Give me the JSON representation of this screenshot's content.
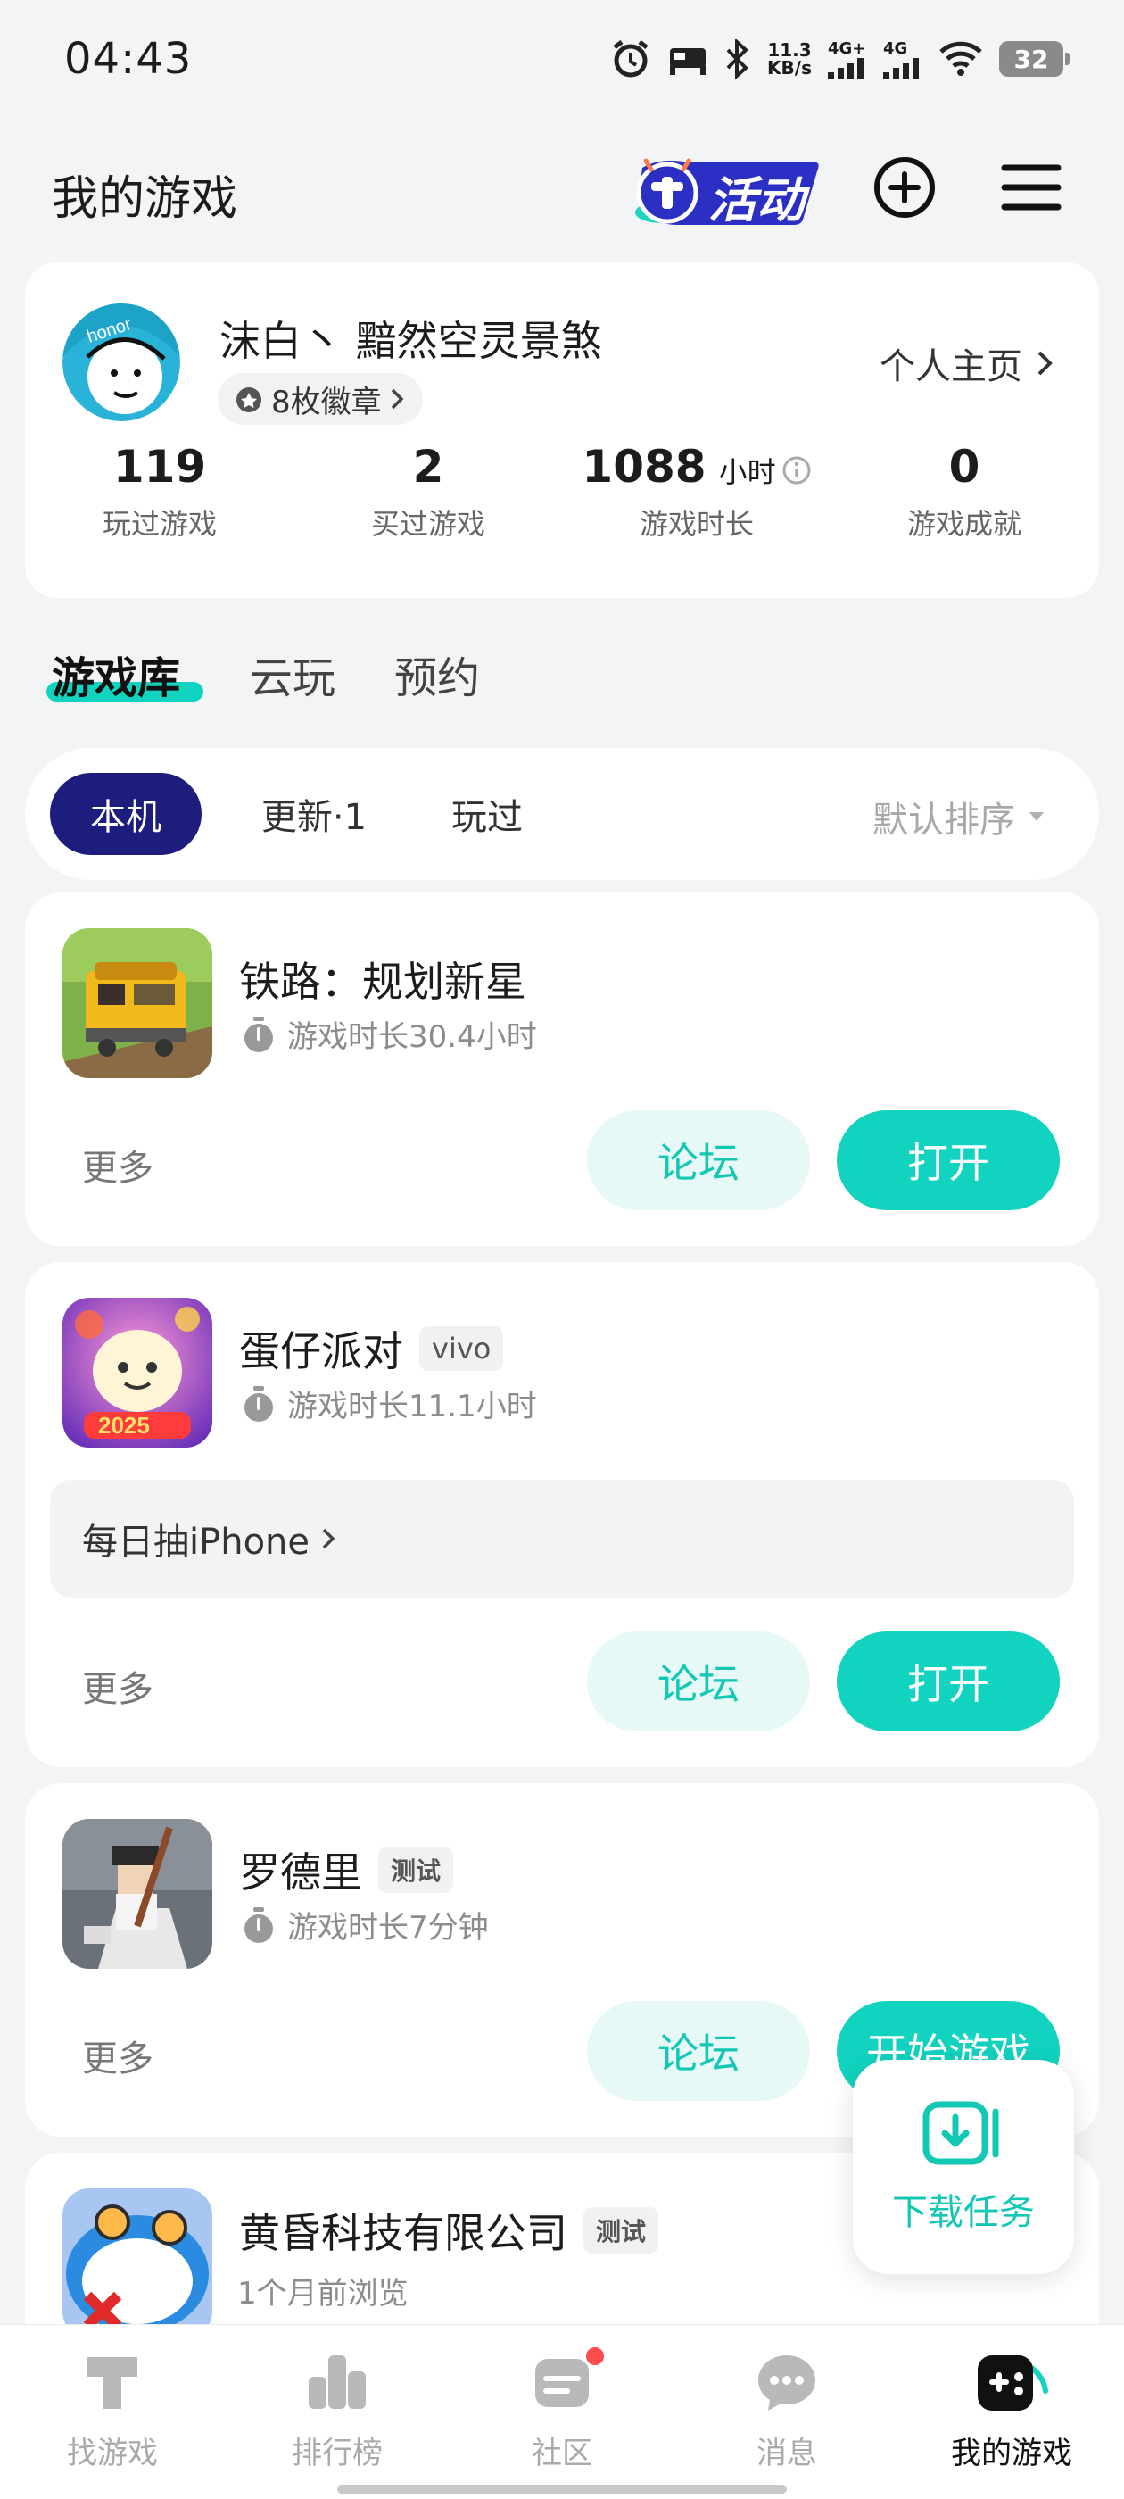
{
  "status_bar": {
    "time": "04:43",
    "net_speed_value": "11.3",
    "net_speed_unit": "KB/s",
    "signal1_label": "4G+",
    "signal2_label": "4G",
    "battery": "32"
  },
  "header": {
    "title": "我的游戏",
    "activity_label": "活动"
  },
  "profile": {
    "username": "沫白丶 黯然空灵景煞",
    "badge_count_label": "8枚徽章",
    "homepage_link": "个人主页",
    "stats": [
      {
        "value": "119",
        "unit": "",
        "label": "玩过游戏"
      },
      {
        "value": "2",
        "unit": "",
        "label": "买过游戏"
      },
      {
        "value": "1088",
        "unit": "小时",
        "label": "游戏时长"
      },
      {
        "value": "0",
        "unit": "",
        "label": "游戏成就"
      }
    ]
  },
  "tabs": [
    {
      "label": "游戏库",
      "active": true
    },
    {
      "label": "云玩",
      "active": false
    },
    {
      "label": "预约",
      "active": false
    }
  ],
  "filters": {
    "chips": [
      {
        "label": "本机",
        "active": true
      },
      {
        "label": "更新·1",
        "active": false
      },
      {
        "label": "玩过",
        "active": false
      }
    ],
    "sort_label": "默认排序"
  },
  "games": [
    {
      "name": "铁路：规划新星",
      "tag": "",
      "playtime": "游戏时长30.4小时",
      "more_label": "更多",
      "forum_label": "论坛",
      "action_label": "打开"
    },
    {
      "name": "蛋仔派对",
      "tag": "vivo",
      "playtime": "游戏时长11.1小时",
      "promo": "每日抽iPhone",
      "more_label": "更多",
      "forum_label": "论坛",
      "action_label": "打开"
    },
    {
      "name": "罗德里",
      "tag": "测试",
      "playtime": "游戏时长7分钟",
      "more_label": "更多",
      "forum_label": "论坛",
      "action_label": "开始游戏"
    },
    {
      "name": "黄昏科技有限公司",
      "tag": "测试",
      "playtime": "1个月前浏览"
    }
  ],
  "download_task": {
    "label": "下载任务"
  },
  "bottom_nav": [
    {
      "label": "找游戏",
      "icon": "find-game-icon",
      "active": false
    },
    {
      "label": "排行榜",
      "icon": "ranking-icon",
      "active": false
    },
    {
      "label": "社区",
      "icon": "community-icon",
      "active": false,
      "has_dot": true
    },
    {
      "label": "消息",
      "icon": "message-icon",
      "active": false
    },
    {
      "label": "我的游戏",
      "icon": "my-games-icon",
      "active": true
    }
  ],
  "colors": {
    "accent": "#12d3c0",
    "accent_light": "#e6f9f7",
    "chip_active": "#1d1d7d",
    "background": "#f3f4f6",
    "notification_dot": "#ff4d4f"
  }
}
